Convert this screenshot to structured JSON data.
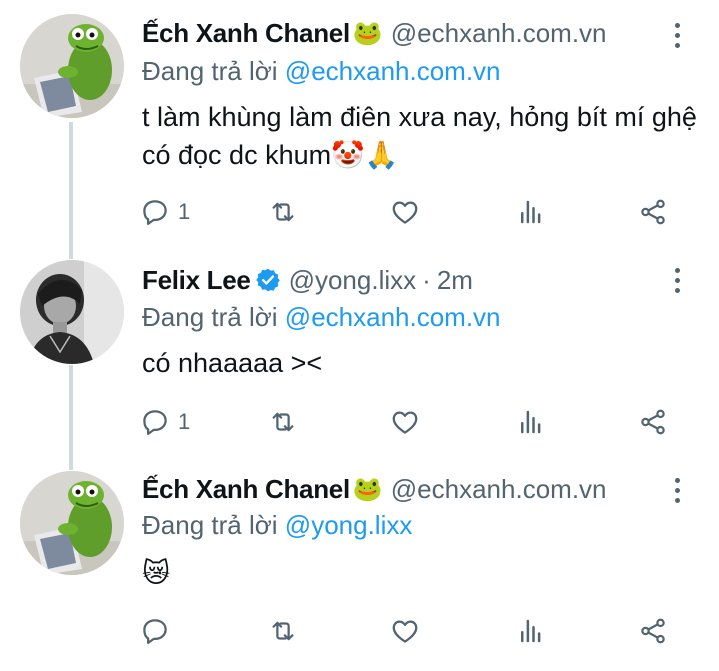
{
  "tweets": [
    {
      "display_name": "Ếch Xanh Chanel",
      "name_emoji": "🐸",
      "handle": "@echxanh.com.vn",
      "reply_prefix": "Đang trả lời",
      "reply_to": "@echxanh.com.vn",
      "text": "t làm khùng làm điên xưa nay, hỏng bít mí ghệ có đọc dc khum🤡🙏",
      "reply_count": "1",
      "avatar": "kermit-frog-laptop-avatar"
    },
    {
      "display_name": "Felix Lee",
      "verified": true,
      "handle": "@yong.lixx",
      "separator": "·",
      "time": "2m",
      "reply_prefix": "Đang trả lời",
      "reply_to": "@echxanh.com.vn",
      "text": "có nhaaaaa ><",
      "reply_count": "1",
      "avatar": "monochrome-portrait-avatar"
    },
    {
      "display_name": "Ếch Xanh Chanel",
      "name_emoji": "🐸",
      "handle": "@echxanh.com.vn",
      "reply_prefix": "Đang trả lời",
      "reply_to": "@yong.lixx",
      "text": "😿",
      "reply_count": "",
      "avatar": "kermit-frog-laptop-avatar"
    }
  ],
  "colors": {
    "accent": "#1d9bf0",
    "secondary_text": "#536471",
    "primary_text": "#0f1419",
    "thread_line": "#cfd9de"
  },
  "icons": [
    "reply-icon",
    "retweet-icon",
    "like-icon",
    "views-icon",
    "share-icon",
    "more-icon",
    "verified-icon"
  ]
}
